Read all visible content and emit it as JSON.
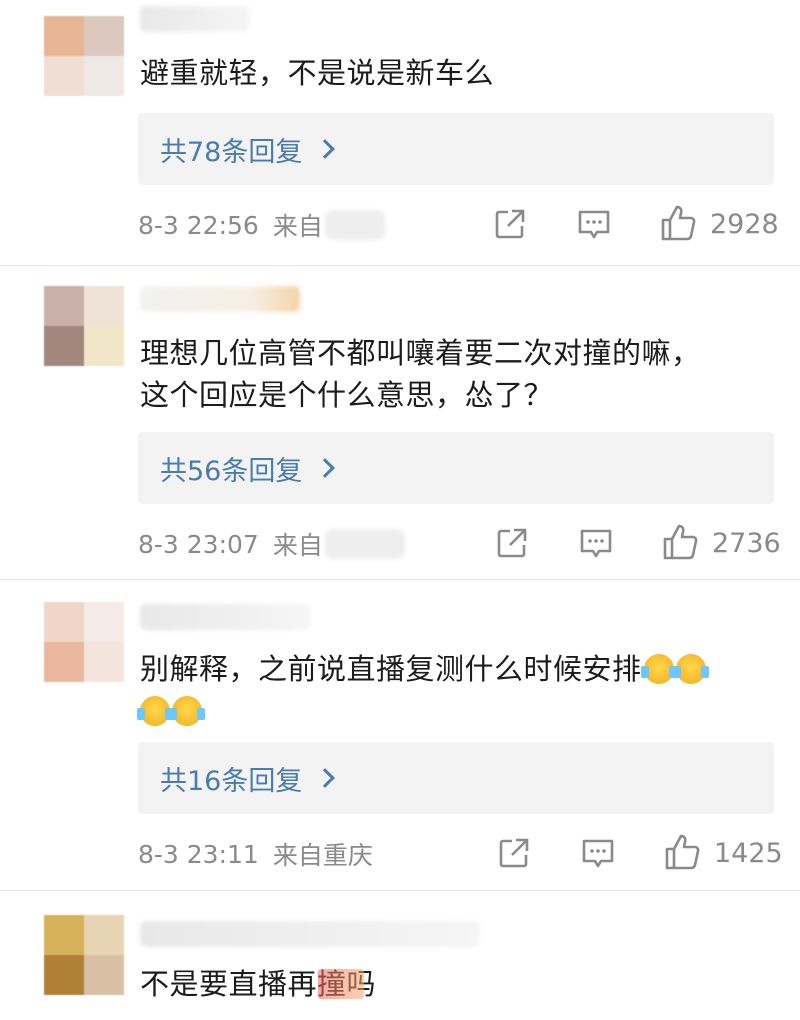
{
  "comments": [
    {
      "text": "避重就轻，不是说是新车么",
      "replies": "共78条回复",
      "time": "8-3 22:56",
      "source": "来自",
      "likes": "2928"
    },
    {
      "text_line1": "理想几位高管不都叫嚷着要二次对撞的嘛，",
      "text_line2": "这个回应是个什么意思，怂了？",
      "replies": "共56条回复",
      "time": "8-3 23:07",
      "source": "来自",
      "likes": "2736"
    },
    {
      "text": "别解释，之前说直播复测什么时候安排",
      "replies": "共16条回复",
      "time": "8-3 23:11",
      "source": "来自重庆",
      "likes": "1425"
    },
    {
      "text": "不是要直播再撞吗"
    }
  ],
  "icons": {
    "share": "share-icon",
    "comment": "comment-icon",
    "like": "thumbs-up-icon",
    "chevron": "chevron-right-icon",
    "emoji": "scream-emoji-icon"
  },
  "colors": {
    "link": "#4a7bb0",
    "meta": "#8a8a8a",
    "reply_box": "#f3f3f3"
  }
}
